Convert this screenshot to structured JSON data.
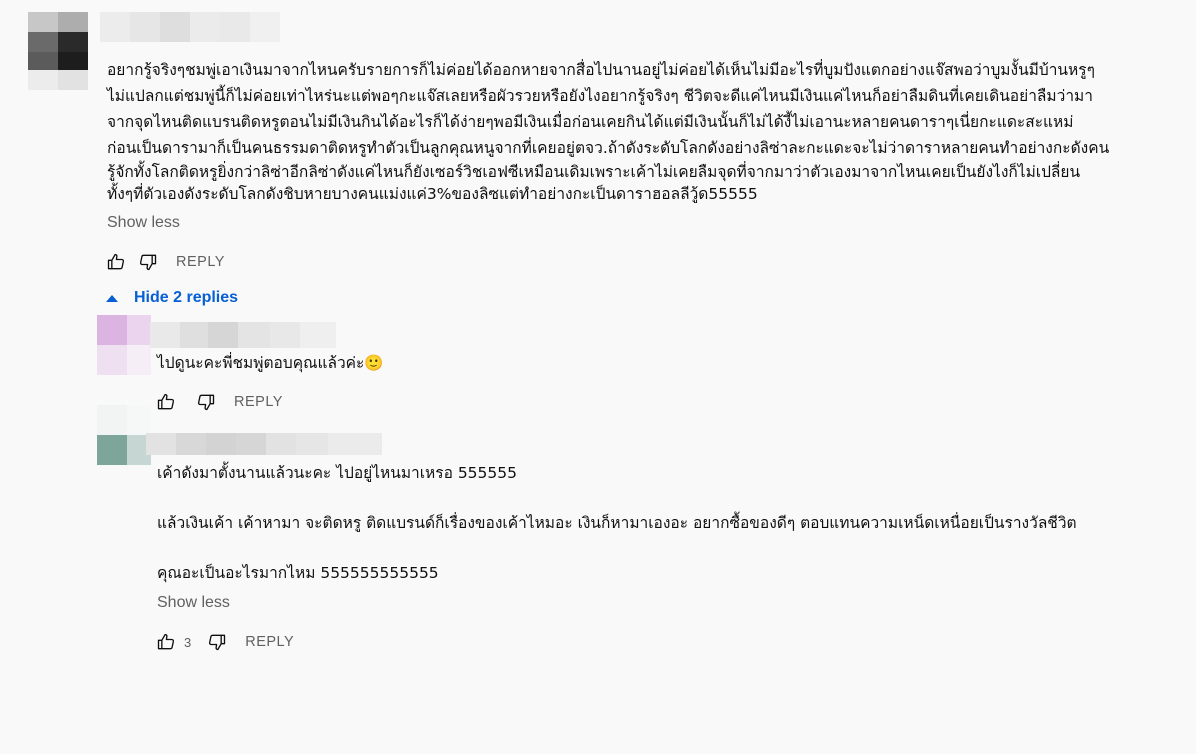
{
  "top_comment": {
    "lines": [
      "อยากรู้จริงๆชมพู่เอาเงินมาจากไหนครับรายการก็ไม่ค่อยได้ออกหายจากสื่อไปนานอยู่ไม่ค่อยได้เห็นไม่มีอะไรที่บูมปังแตกอย่างแจ๊สพอว่าบูมงั้นมีบ้านหรูๆ",
      "ไม่แปลกแต่ชมพู่นี้ก็ไม่ค่อยเท่าไหร่นะแต่พอๆกะแจ๊สเลยหรือผัวรวยหรือยังไงอยากรู้จริงๆ ชีวิตจะดีแค่ไหนมีเงินแค่ไหนก็อย่าลืมดินที่เคยเดินอย่าลืมว่ามา",
      "จากจุดไหนติดแบรนติดหรูตอนไม่มีเงินกินได้อะไรก็ได้ง่ายๆพอมีเงินเมื่อก่อนเคยกินได้แต่มีเงินนั้นก็ไม่ได้งี้ไม่เอานะหลายคนดาราๆเนี่ยกะแดะสะแหม่",
      "ก่อนเป็นดารามาก็เป็นคนธรรมดาติดหรูทำตัวเป็นลูกคุณหนูจากที่เคยอยู่ตจว.ถ้าดังระดับโลกดังอย่างลิซ่าละกะแดะจะไม่ว่าดาราหลายคนทำอย่างกะดังคน",
      "รู้จักทั้งโลกติดหรูยิ่งกว่าลิซ่าอีกลิซ่าดังแค่ไหนก็ยังเซอร์วิชเอฟซีเหมือนเดิมเพราะเค้าไม่เคยลืมจุดที่จากมาว่าตัวเองมาจากไหนเคยเป็นยังไงก็ไม่เปลี่ยน",
      "ทั้งๆที่ตัวเองดังระดับโลกดังชิบหายบางคนแม่งแค่3%ของลิซแต่ทำอย่างกะเป็นดาราฮอลลีวู้ด55555"
    ],
    "show_less": "Show less",
    "reply_label": "REPLY"
  },
  "hide_replies": "Hide 2 replies",
  "replies": [
    {
      "text": "ไปดูนะคะพี่ชมพู่ตอบคุณแล้วค่ะ🙂",
      "reply_label": "REPLY"
    },
    {
      "paragraphs": [
        "เค้าดังมาตั้งนานแล้วนะคะ ไปอยู่ไหนมาเหรอ 555555",
        "แล้วเงินเค้า เค้าหามา จะติดหรู ติดแบรนด์ก็เรื่องของเค้าไหมอะ เงินก็หามาเองอะ อยากซื้อของดีๆ ตอบแทนความเหน็ดเหนื่อยเป็นรางวัลชีวิต",
        "คุณอะเป็นอะไรมากไหม 555555555555"
      ],
      "show_less": "Show less",
      "like_count": "3",
      "reply_label": "REPLY"
    }
  ],
  "colors": {
    "link_blue": "#065fd4",
    "secondary_text": "#606060",
    "background": "#f9f9f9"
  }
}
